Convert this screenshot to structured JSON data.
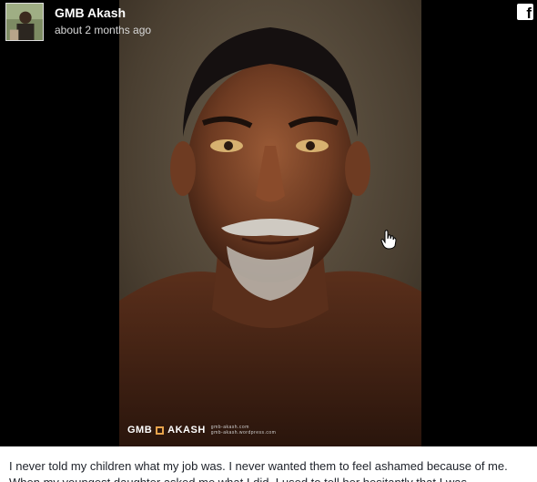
{
  "post": {
    "author": "GMB Akash",
    "time": "about 2 months ago",
    "platform_icon": "facebook-icon",
    "caption": "I never told my children what my job was. I never wanted them to feel ashamed because of me. When my youngest daughter asked me what I did, I used to tell her hesitantly that I was"
  },
  "photo": {
    "subject": "portrait-photo",
    "watermark_left": "GMB",
    "watermark_right": "AKASH",
    "watermark_sub_1": "gmb-akash.com",
    "watermark_sub_2": "gmb-akash.wordpress.com"
  },
  "colors": {
    "background": "#000000",
    "watermark_accent": "#e7a34c",
    "caption_text": "#1d2129"
  }
}
